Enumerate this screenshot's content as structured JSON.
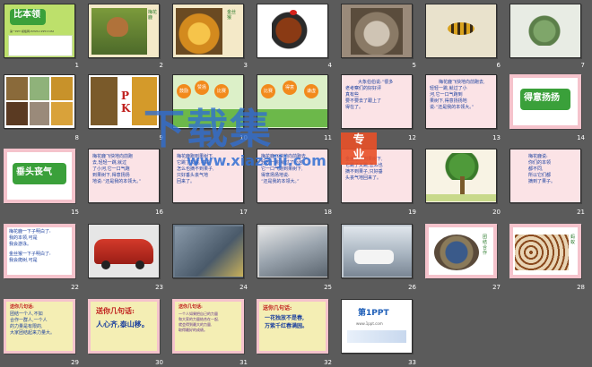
{
  "watermark": {
    "text": "下载集",
    "badge_line1": "专",
    "badge_line2": "业",
    "url": "www.xiazaiji.com"
  },
  "slides": [
    {
      "n": "1",
      "title": "比本领",
      "lines": [
        "第一PPT 模板网-WWW.1PPT.COM"
      ]
    },
    {
      "n": "2",
      "caption": "梅花鹿"
    },
    {
      "n": "3",
      "caption": "金丝猴"
    },
    {
      "n": "4"
    },
    {
      "n": "5"
    },
    {
      "n": "6"
    },
    {
      "n": "7"
    },
    {
      "n": "8"
    },
    {
      "n": "9",
      "pk": "PK"
    },
    {
      "n": "10",
      "balls": [
        "鼓励",
        "赞扬",
        "比赛"
      ]
    },
    {
      "n": "11",
      "balls": [
        "比赛",
        "得意",
        "谦虚"
      ]
    },
    {
      "n": "12",
      "lines": [
        "大象伯伯说:“很多",
        "老考察们的好好评",
        "真有些",
        "要不要去了跟上了",
        "得在了。"
      ]
    },
    {
      "n": "13",
      "lines": [
        "梅花鹿飞快地向前跑去,",
        "轻轻一跳,就过了小",
        "河,它一口气跑到",
        "果树下,得意扬扬地",
        "说:“还是我的本领大。”"
      ]
    },
    {
      "n": "14",
      "title": "得意扬扬"
    },
    {
      "n": "15",
      "title": "垂头丧气"
    },
    {
      "n": "16",
      "lines": [
        "梅花鹿飞快地向前跑",
        "去,轻轻一跳,就过",
        "了小河,它一口气跑",
        "到果树下,得意扬扬",
        "地说:“还是我的本领大。”"
      ]
    },
    {
      "n": "17",
      "lines": [
        "梅花鹿跑到果树下,",
        "它跳了又跳,可是",
        "怎么也摘不到果子,",
        "只好垂头丧气地",
        "回来了。"
      ]
    },
    {
      "n": "18",
      "lines": [
        "梅花鹿飞快地向前跑去,",
        "轻轻一跳,就过了小河,",
        "它一口气跑到果树下,",
        "得意扬扬地说:",
        "“还是我的本领大。”"
      ]
    },
    {
      "n": "19",
      "lines": [
        "金丝猴来到果树下,",
        "它跳了又跳,怎么也",
        "摘不到果子,只好垂",
        "头丧气地回来了。"
      ]
    },
    {
      "n": "20"
    },
    {
      "n": "21",
      "lines": [
        "梅花鹿说:",
        "你们的本领",
        "都不同,",
        "所以它们都",
        "摘到了果子。"
      ]
    },
    {
      "n": "22",
      "lines": [
        "梅花鹿一下子明白了:",
        "我的本领,可是",
        "我会游泳。",
        "金丝猴一下子明白了:",
        "我会爬树,可是"
      ]
    },
    {
      "n": "23"
    },
    {
      "n": "24"
    },
    {
      "n": "25"
    },
    {
      "n": "26"
    },
    {
      "n": "27",
      "caption": "团结合作"
    },
    {
      "n": "28",
      "caption": "蚂蚁"
    },
    {
      "n": "29",
      "lines": [
        "送你几句话:",
        "团结一个人,不如",
        "合作一群人,一个人",
        "的力量是有限的,",
        "大家团结起来力量大。"
      ]
    },
    {
      "n": "30",
      "title": "送你几句话:",
      "lines": [
        "人心齐,泰山移。"
      ]
    },
    {
      "n": "31",
      "lines": [
        "送你几句话:",
        "一个人如果把自己的力量",
        "和大家的力量结合在一起,",
        "就会得到最大的力量,",
        "取得最好的成绩。"
      ]
    },
    {
      "n": "32",
      "title": "送你几句话:",
      "lines": [
        "一花独放不是春,",
        "万紫千红春满园。"
      ]
    },
    {
      "n": "33",
      "logo": "第1PPT",
      "sub": "www.1ppt.com"
    }
  ],
  "colors": {
    "background": "#5b5b5b",
    "slide_border": "#2e2e2e",
    "pink_slide": "#fbe3e6",
    "green_title": "#3aa03a",
    "blue_text": "#1a3f9e",
    "red_text": "#c0201e"
  }
}
